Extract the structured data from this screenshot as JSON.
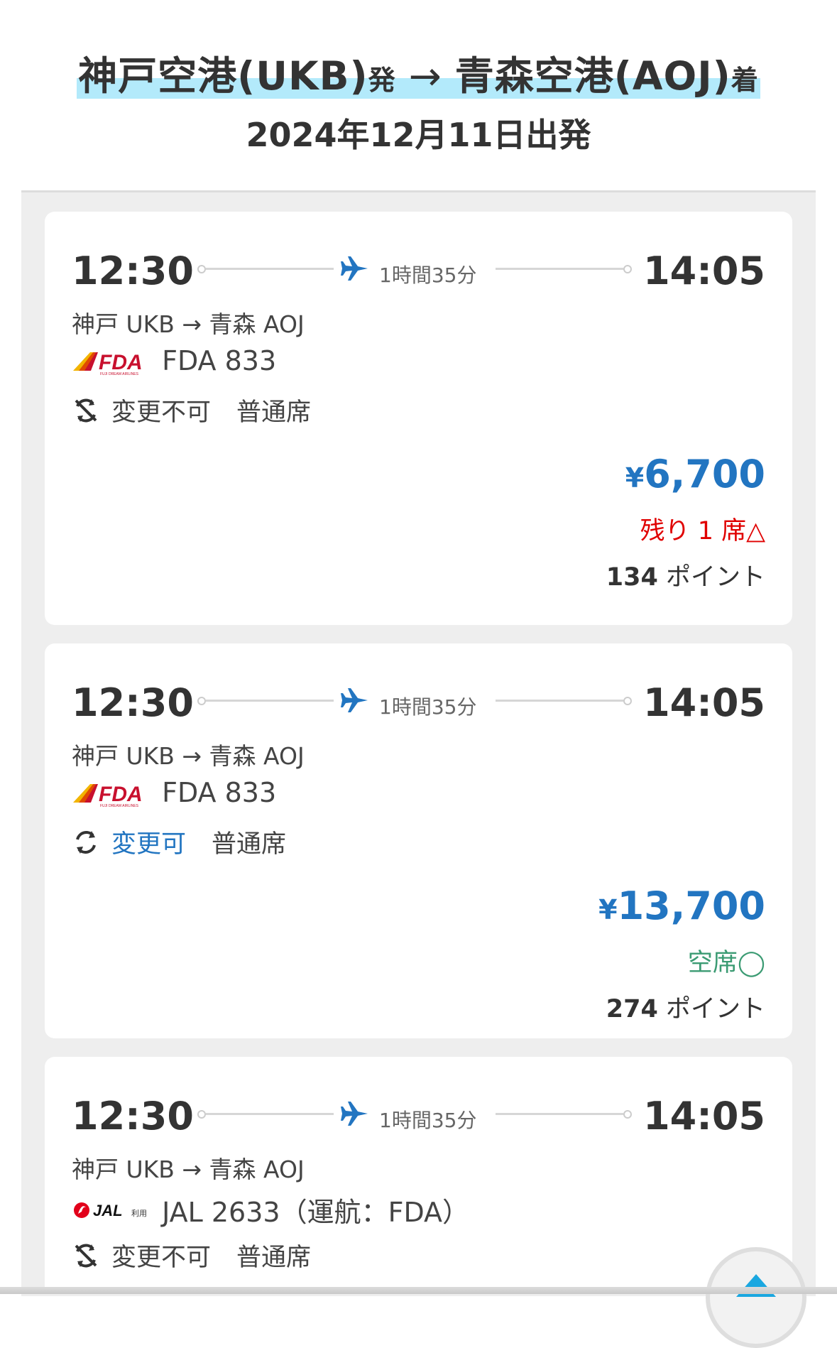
{
  "header": {
    "origin": "神戸空港(UKB)",
    "origin_suffix": "発",
    "arrow": "→",
    "destination": "青森空港(AOJ)",
    "destination_suffix": "着",
    "date": "2024年12月11日出発"
  },
  "colors": {
    "accent_blue": "#2275c1",
    "highlight": "#b3eafb",
    "alert_red": "#e00000",
    "available_green": "#3b9b73"
  },
  "flights": [
    {
      "dep_time": "12:30",
      "arr_time": "14:05",
      "duration": "1時間35分",
      "route": "神戸 UKB → 青森 AOJ",
      "airline_logo": "fda-logo",
      "flight": "FDA 833",
      "change_icon": "no-change-icon",
      "change": "変更不可",
      "seat_class": "普通席",
      "price_symbol": "¥",
      "price": "6,700",
      "availability": "残り 1 席△",
      "points_value": "134",
      "points_unit": " ポイント"
    },
    {
      "dep_time": "12:30",
      "arr_time": "14:05",
      "duration": "1時間35分",
      "route": "神戸 UKB → 青森 AOJ",
      "airline_logo": "fda-logo",
      "flight": "FDA 833",
      "change_icon": "changeable-icon",
      "change": "変更可",
      "seat_class": "普通席",
      "price_symbol": "¥",
      "price": "13,700",
      "availability": "空席◯",
      "points_value": "274",
      "points_unit": " ポイント"
    },
    {
      "dep_time": "12:30",
      "arr_time": "14:05",
      "duration": "1時間35分",
      "route": "神戸 UKB → 青森 AOJ",
      "airline_logo": "jal-logo",
      "flight": "JAL 2633（運航：FDA）",
      "change_icon": "no-change-icon",
      "change": "変更不可",
      "seat_class": "普通席"
    }
  ],
  "logos": {
    "fda_text": "FDA",
    "fda_sub": "FUJI DREAM AIRLINES",
    "jal_text": "JAL",
    "jal_sub": "利用"
  }
}
